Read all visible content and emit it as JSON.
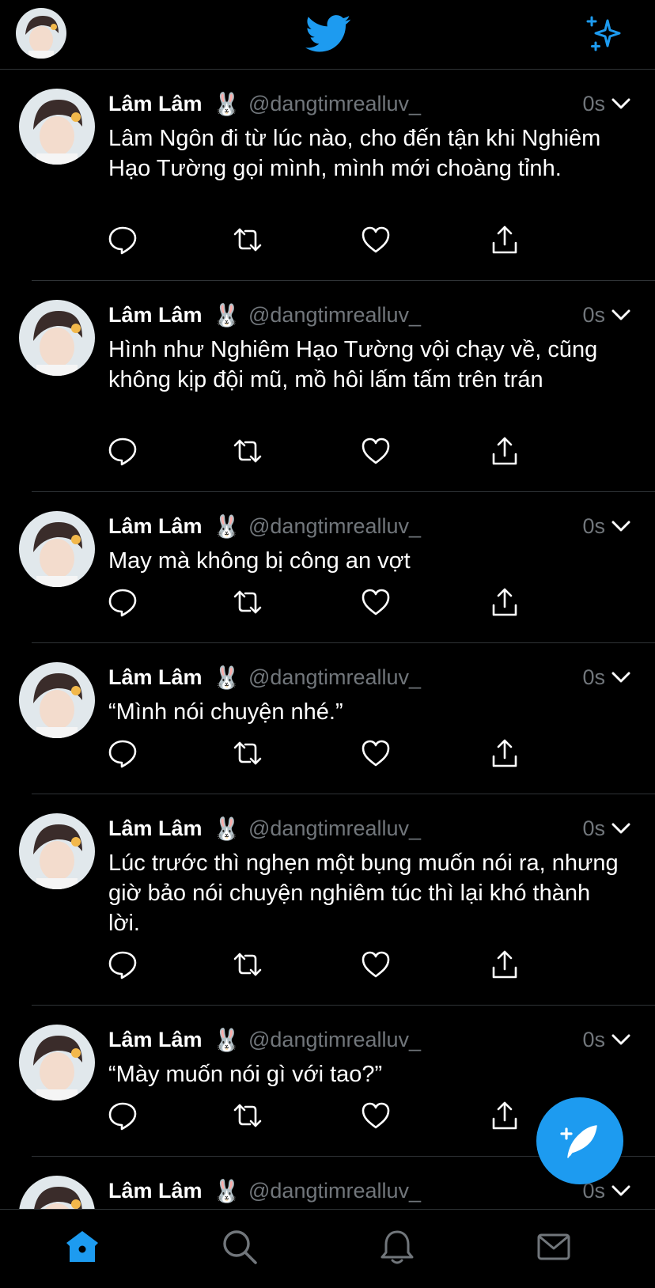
{
  "colors": {
    "accent": "#1d9bf0",
    "text": "#ffffff",
    "muted": "#71767b",
    "divider": "#2f3336",
    "background": "#000000"
  },
  "header": {
    "logo_icon": "twitter-bird-icon",
    "sparkle_icon": "sparkle-icon"
  },
  "tweets": [
    {
      "name": "Lâm Lâm",
      "emoji": "🐰",
      "handle": "@dangtimrealluv_",
      "time": "0s",
      "text": "Lâm Ngôn đi từ lúc nào, cho đến tận khi Nghiêm Hạo Tường gọi mình, mình mới choàng tỉnh."
    },
    {
      "name": "Lâm Lâm",
      "emoji": "🐰",
      "handle": "@dangtimrealluv_",
      "time": "0s",
      "text": "Hình như Nghiêm Hạo Tường vội chạy về, cũng không kịp đội mũ, mồ hôi lấm tấm trên trán"
    },
    {
      "name": "Lâm Lâm",
      "emoji": "🐰",
      "handle": "@dangtimrealluv_",
      "time": "0s",
      "text": "May mà không bị công an vợt"
    },
    {
      "name": "Lâm Lâm",
      "emoji": "🐰",
      "handle": "@dangtimrealluv_",
      "time": "0s",
      "text": "“Mình nói chuyện nhé.”"
    },
    {
      "name": "Lâm Lâm",
      "emoji": "🐰",
      "handle": "@dangtimrealluv_",
      "time": "0s",
      "text": "Lúc trước thì nghẹn một bụng muốn nói ra, nhưng giờ bảo nói chuyện nghiêm túc thì lại khó thành lời."
    },
    {
      "name": "Lâm Lâm",
      "emoji": "🐰",
      "handle": "@dangtimrealluv_",
      "time": "0s",
      "text": "“Mày muốn nói gì với tao?”"
    },
    {
      "name": "Lâm Lâm",
      "emoji": "🐰",
      "handle": "@dangtimrealluv_",
      "time": "0s",
      "text": ""
    }
  ],
  "action_icons": [
    "reply-icon",
    "retweet-icon",
    "like-icon",
    "share-icon"
  ],
  "bottom_nav": [
    "home-icon",
    "search-icon",
    "notifications-icon",
    "messages-icon"
  ]
}
